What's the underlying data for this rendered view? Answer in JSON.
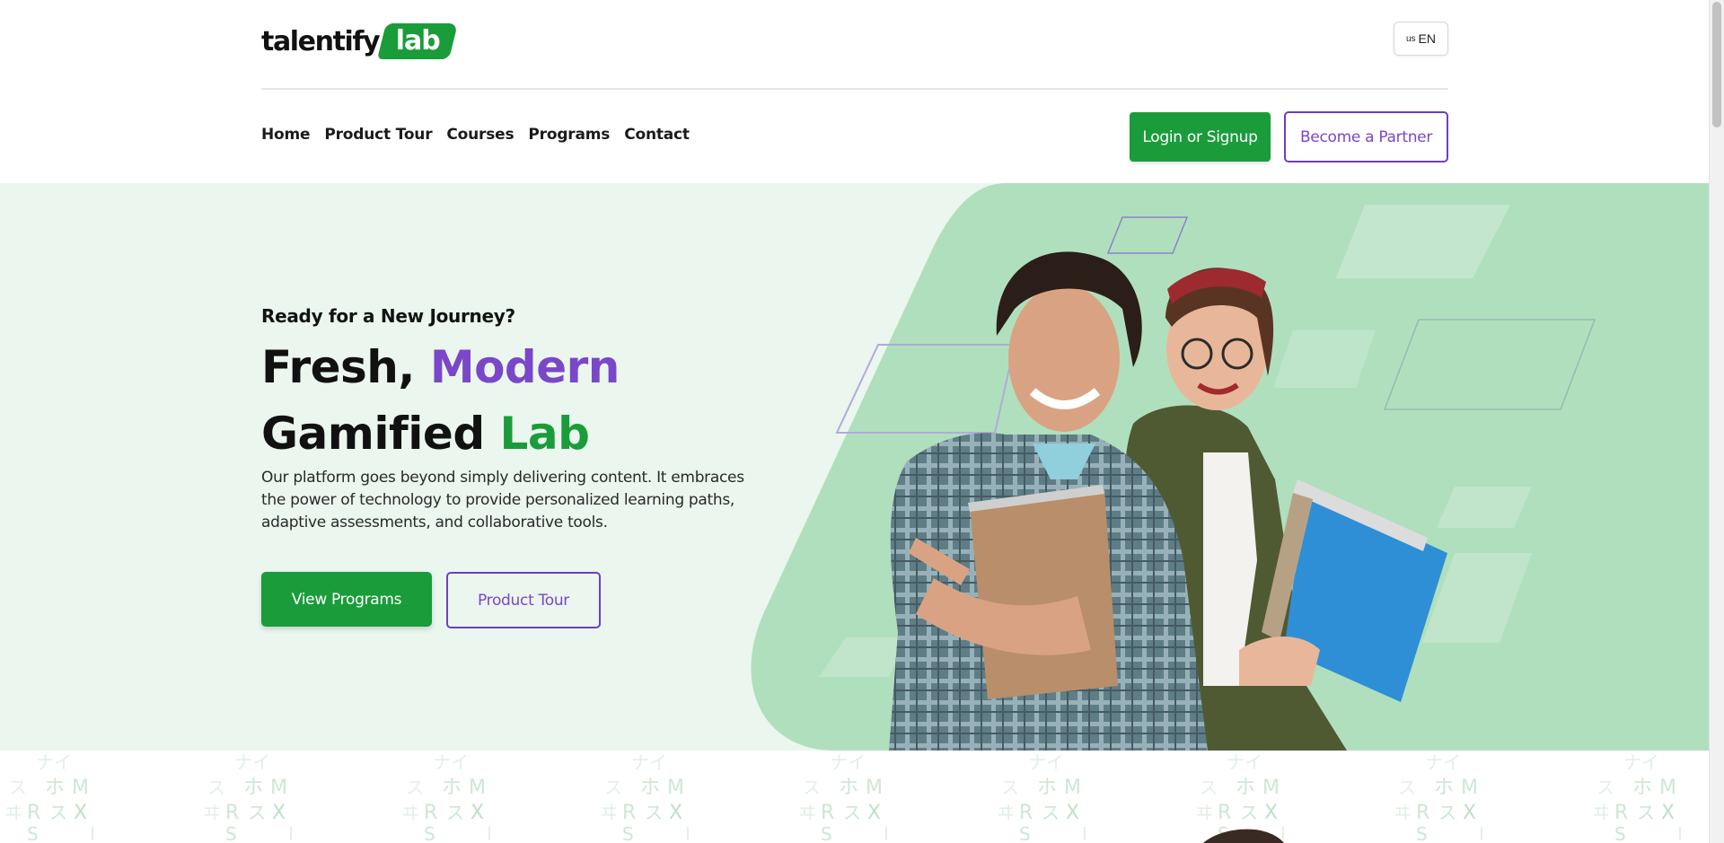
{
  "header": {
    "logo_main": "talentify",
    "logo_badge": "lab",
    "language": {
      "flag": "us",
      "code": "EN"
    }
  },
  "nav": {
    "items": [
      {
        "label": "Home"
      },
      {
        "label": "Product Tour"
      },
      {
        "label": "Courses"
      },
      {
        "label": "Programs"
      },
      {
        "label": "Contact"
      }
    ],
    "login_label": "Login or Signup",
    "partner_label": "Become a Partner"
  },
  "hero": {
    "eyebrow": "Ready for a New Journey?",
    "headline_part1": "Fresh,",
    "headline_part2": "Modern",
    "headline_part3": "Gamified",
    "headline_part4": "Lab",
    "description": "Our platform goes beyond simply delivering content. It embraces the power of technology to provide personalized learning paths, adaptive assessments, and collaborative tools.",
    "primary_button": "View Programs",
    "secondary_button": "Product Tour",
    "image_icon": "students-photo-illustration"
  },
  "colors": {
    "brand_green": "#1a9c3a",
    "brand_purple": "#7a47c9",
    "hero_bg": "#eaf6ee",
    "hero_blob": "#b0dfbd"
  }
}
